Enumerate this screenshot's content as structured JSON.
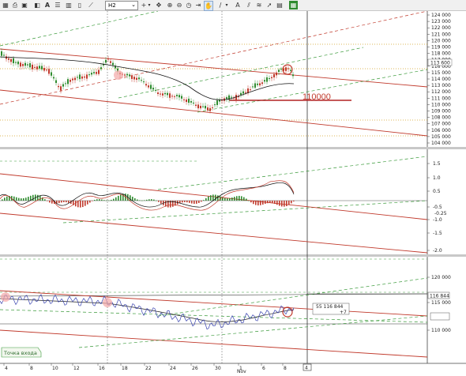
{
  "toolbar": {
    "timeframe": "H2",
    "timeframe_arrow": "⌄",
    "icons": [
      "layout-icon",
      "print-icon",
      "save-icon",
      "palette-icon",
      "font-icon",
      "list-icon",
      "crosshair-icon",
      "dropdown-icon",
      "move-icon",
      "zoom-in-icon",
      "zoom-out-icon",
      "clock-icon",
      "line-icon",
      "fib-icon",
      "trendline-icon",
      "hand-icon",
      "cursor-icon",
      "dropdown-icon",
      "text-icon",
      "tool-icon",
      "tool-icon",
      "tool-icon",
      "hatch-icon",
      "active-tool-icon"
    ]
  },
  "main": {
    "annotation": "110000",
    "price_labels": [
      "124 000",
      "123 000",
      "122 000",
      "121 000",
      "120 000",
      "119 000",
      "118 000",
      "117 000",
      "116 000",
      "115 000",
      "114 000",
      "113 000",
      "112 000",
      "111 000",
      "110 000",
      "109 000",
      "108 000",
      "107 000",
      "106 000",
      "105 000",
      "104 000"
    ],
    "current_price": "113 600"
  },
  "oscillator": {
    "labels": [
      "1.5",
      "1.0",
      "0.5",
      "0",
      "-0.5",
      "-1.0",
      "-1.5",
      "-2.0"
    ],
    "current_value": "-0.25"
  },
  "equity": {
    "labels": [
      "120 000",
      "115 000",
      "110 000"
    ],
    "current_value": "116 844",
    "tooltip_line1": "55    116 844",
    "tooltip_line2": "+7",
    "entry_label": "Точка входа"
  },
  "time_axis": {
    "labels": [
      "4",
      "8",
      "10",
      "12",
      "16",
      "18",
      "22",
      "24",
      "26",
      "30",
      "1",
      "6",
      "8"
    ],
    "month": "Nov"
  },
  "colors": {
    "channel_red": "#c0392b",
    "channel_green": "#3a9a3a",
    "candle_up": "#2e8b2e",
    "candle_down": "#c0392b",
    "equity_blue": "#3a44b0",
    "level_orange": "#d4a020"
  }
}
